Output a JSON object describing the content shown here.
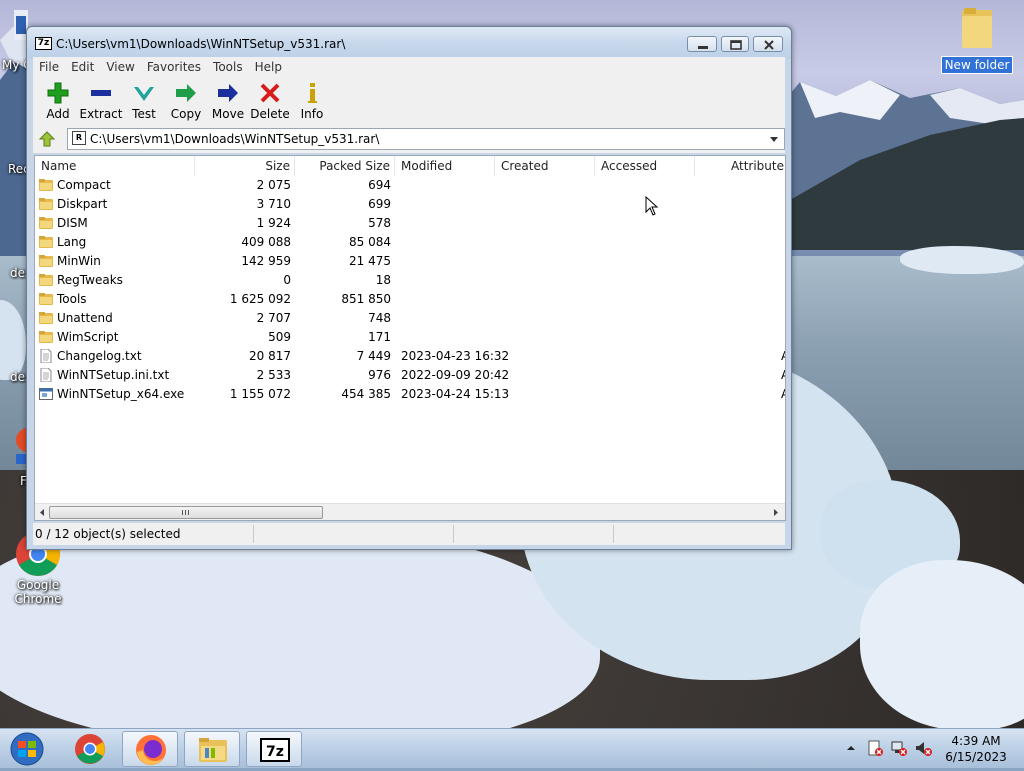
{
  "desktop": {
    "icons": [
      {
        "label": "New folder"
      },
      {
        "label": "Google\nChrome"
      }
    ],
    "edge_labels": [
      "My C",
      "Rec",
      "des",
      "des",
      "F"
    ]
  },
  "window": {
    "title": "C:\\Users\\vm1\\Downloads\\WinNTSetup_v531.rar\\",
    "title_icon": "7z",
    "menu": [
      "File",
      "Edit",
      "View",
      "Favorites",
      "Tools",
      "Help"
    ],
    "toolbar": [
      {
        "label": "Add",
        "icon": "plus-icon",
        "color": "#1f9e1f"
      },
      {
        "label": "Extract",
        "icon": "minus-icon",
        "color": "#1b2f9e"
      },
      {
        "label": "Test",
        "icon": "check-icon",
        "color": "#1fa39a"
      },
      {
        "label": "Copy",
        "icon": "arrow-right-icon",
        "color": "#1f9e4a"
      },
      {
        "label": "Move",
        "icon": "arrow-right-icon",
        "color": "#1b2f9e"
      },
      {
        "label": "Delete",
        "icon": "x-icon",
        "color": "#d71c1c"
      },
      {
        "label": "Info",
        "icon": "info-icon",
        "color": "#c9a400"
      }
    ],
    "address": "C:\\Users\\vm1\\Downloads\\WinNTSetup_v531.rar\\",
    "columns": [
      "Name",
      "Size",
      "Packed Size",
      "Modified",
      "Created",
      "Accessed",
      "Attribute"
    ],
    "files": [
      {
        "name": "Compact",
        "type": "folder",
        "size": "2 075",
        "packed": "694",
        "modified": ""
      },
      {
        "name": "Diskpart",
        "type": "folder",
        "size": "3 710",
        "packed": "699",
        "modified": ""
      },
      {
        "name": "DISM",
        "type": "folder",
        "size": "1 924",
        "packed": "578",
        "modified": ""
      },
      {
        "name": "Lang",
        "type": "folder",
        "size": "409 088",
        "packed": "85 084",
        "modified": ""
      },
      {
        "name": "MinWin",
        "type": "folder",
        "size": "142 959",
        "packed": "21 475",
        "modified": ""
      },
      {
        "name": "RegTweaks",
        "type": "folder",
        "size": "0",
        "packed": "18",
        "modified": ""
      },
      {
        "name": "Tools",
        "type": "folder",
        "size": "1 625 092",
        "packed": "851 850",
        "modified": ""
      },
      {
        "name": "Unattend",
        "type": "folder",
        "size": "2 707",
        "packed": "748",
        "modified": ""
      },
      {
        "name": "WimScript",
        "type": "folder",
        "size": "509",
        "packed": "171",
        "modified": ""
      },
      {
        "name": "Changelog.txt",
        "type": "text",
        "size": "20 817",
        "packed": "7 449",
        "modified": "2023-04-23 16:32"
      },
      {
        "name": "WinNTSetup.ini.txt",
        "type": "text",
        "size": "2 533",
        "packed": "976",
        "modified": "2022-09-09 20:42"
      },
      {
        "name": "WinNTSetup_x64.exe",
        "type": "exe",
        "size": "1 155 072",
        "packed": "454 385",
        "modified": "2023-04-24 15:13"
      }
    ],
    "status": "0 / 12 object(s) selected"
  },
  "taskbar": {
    "apps": [
      "start-orb",
      "chrome",
      "firefox",
      "file-explorer",
      "7zip"
    ],
    "clock_time": "4:39 AM",
    "clock_date": "6/15/2023"
  }
}
